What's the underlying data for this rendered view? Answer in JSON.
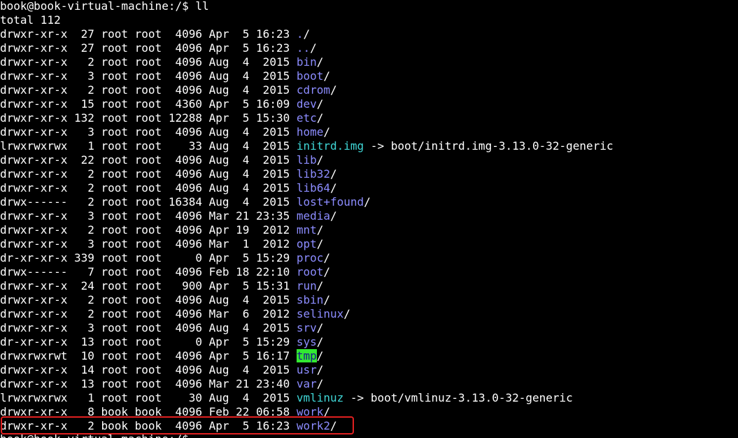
{
  "prompt": {
    "text": "book@book-virtual-machine:/$ ll"
  },
  "total": "total 112",
  "entries": [
    {
      "meta": "drwxr-xr-x  27 root root  4096 Apr  5 16:23 ",
      "name": ".",
      "type": "dir",
      "suffix": "/"
    },
    {
      "meta": "drwxr-xr-x  27 root root  4096 Apr  5 16:23 ",
      "name": "..",
      "type": "dir",
      "suffix": "/"
    },
    {
      "meta": "drwxr-xr-x   2 root root  4096 Aug  4  2015 ",
      "name": "bin",
      "type": "dir",
      "suffix": "/"
    },
    {
      "meta": "drwxr-xr-x   3 root root  4096 Aug  4  2015 ",
      "name": "boot",
      "type": "dir",
      "suffix": "/"
    },
    {
      "meta": "drwxr-xr-x   2 root root  4096 Aug  4  2015 ",
      "name": "cdrom",
      "type": "dir",
      "suffix": "/"
    },
    {
      "meta": "drwxr-xr-x  15 root root  4360 Apr  5 16:09 ",
      "name": "dev",
      "type": "dir",
      "suffix": "/"
    },
    {
      "meta": "drwxr-xr-x 132 root root 12288 Apr  5 15:30 ",
      "name": "etc",
      "type": "dir",
      "suffix": "/"
    },
    {
      "meta": "drwxr-xr-x   3 root root  4096 Aug  4  2015 ",
      "name": "home",
      "type": "dir",
      "suffix": "/"
    },
    {
      "meta": "lrwxrwxrwx   1 root root    33 Aug  4  2015 ",
      "name": "initrd.img",
      "type": "link",
      "suffix": " -> boot/initrd.img-3.13.0-32-generic"
    },
    {
      "meta": "drwxr-xr-x  22 root root  4096 Aug  4  2015 ",
      "name": "lib",
      "type": "dir",
      "suffix": "/"
    },
    {
      "meta": "drwxr-xr-x   2 root root  4096 Aug  4  2015 ",
      "name": "lib32",
      "type": "dir",
      "suffix": "/"
    },
    {
      "meta": "drwxr-xr-x   2 root root  4096 Aug  4  2015 ",
      "name": "lib64",
      "type": "dir",
      "suffix": "/"
    },
    {
      "meta": "drwx------   2 root root 16384 Aug  4  2015 ",
      "name": "lost+found",
      "type": "dir",
      "suffix": "/"
    },
    {
      "meta": "drwxr-xr-x   3 root root  4096 Mar 21 23:35 ",
      "name": "media",
      "type": "dir",
      "suffix": "/"
    },
    {
      "meta": "drwxr-xr-x   2 root root  4096 Apr 19  2012 ",
      "name": "mnt",
      "type": "dir",
      "suffix": "/"
    },
    {
      "meta": "drwxr-xr-x   3 root root  4096 Mar  1  2012 ",
      "name": "opt",
      "type": "dir",
      "suffix": "/"
    },
    {
      "meta": "dr-xr-xr-x 339 root root     0 Apr  5 15:29 ",
      "name": "proc",
      "type": "dir",
      "suffix": "/"
    },
    {
      "meta": "drwx------   7 root root  4096 Feb 18 22:10 ",
      "name": "root",
      "type": "dir",
      "suffix": "/"
    },
    {
      "meta": "drwxr-xr-x  24 root root   900 Apr  5 15:31 ",
      "name": "run",
      "type": "dir",
      "suffix": "/"
    },
    {
      "meta": "drwxr-xr-x   2 root root  4096 Aug  4  2015 ",
      "name": "sbin",
      "type": "dir",
      "suffix": "/"
    },
    {
      "meta": "drwxr-xr-x   2 root root  4096 Mar  6  2012 ",
      "name": "selinux",
      "type": "dir",
      "suffix": "/"
    },
    {
      "meta": "drwxr-xr-x   3 root root  4096 Aug  4  2015 ",
      "name": "srv",
      "type": "dir",
      "suffix": "/"
    },
    {
      "meta": "dr-xr-xr-x  13 root root     0 Apr  5 15:29 ",
      "name": "sys",
      "type": "dir",
      "suffix": "/"
    },
    {
      "meta": "drwxrwxrwt  10 root root  4096 Apr  5 16:17 ",
      "name": "tmp",
      "type": "sticky",
      "suffix": "/"
    },
    {
      "meta": "drwxr-xr-x  14 root root  4096 Aug  4  2015 ",
      "name": "usr",
      "type": "dir",
      "suffix": "/"
    },
    {
      "meta": "drwxr-xr-x  13 root root  4096 Mar 21 23:40 ",
      "name": "var",
      "type": "dir",
      "suffix": "/"
    },
    {
      "meta": "lrwxrwxrwx   1 root root    30 Aug  4  2015 ",
      "name": "vmlinuz",
      "type": "link",
      "suffix": " -> boot/vmlinuz-3.13.0-32-generic"
    },
    {
      "meta": "drwxr-xr-x   8 book book  4096 Feb 22 06:58 ",
      "name": "work",
      "type": "dir",
      "suffix": "/"
    },
    {
      "meta": "drwxr-xr-x   2 book book  4096 Apr  5 16:23 ",
      "name": "work2",
      "type": "dir",
      "suffix": "/"
    }
  ],
  "next_prompt": {
    "text": "book@book-virtual-machine:/$"
  },
  "colors": {
    "background": "#000000",
    "text": "#ffffff",
    "directory": "#8c8cff",
    "symlink": "#3fd6d6",
    "sticky_bg": "#32e832",
    "sticky_fg": "#1a1a8c",
    "highlight_border": "#e02020"
  },
  "highlight": {
    "entry_name": "work2"
  }
}
